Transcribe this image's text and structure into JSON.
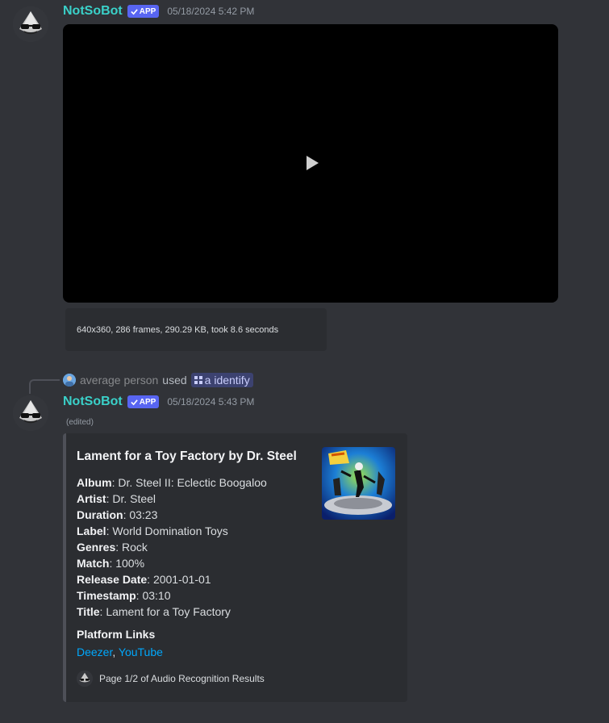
{
  "messages": [
    {
      "username": "NotSoBot",
      "badge": "APP",
      "timestamp": "05/18/2024 5:42 PM",
      "attachment_stats": "640x360, 286 frames, 290.29 KB, took 8.6 seconds"
    },
    {
      "reply": {
        "user": "average person",
        "used": "used",
        "command": "a identify"
      },
      "username": "NotSoBot",
      "badge": "APP",
      "timestamp": "05/18/2024 5:43 PM",
      "edited": "(edited)",
      "embed": {
        "title": "Lament for a Toy Factory by Dr. Steel",
        "fields": [
          {
            "name": "Album",
            "value": "Dr. Steel II: Eclectic Boogaloo"
          },
          {
            "name": "Artist",
            "value": "Dr. Steel"
          },
          {
            "name": "Duration",
            "value": "03:23"
          },
          {
            "name": "Label",
            "value": "World Domination Toys"
          },
          {
            "name": "Genres",
            "value": "Rock"
          },
          {
            "name": "Match",
            "value": "100%"
          },
          {
            "name": "Release Date",
            "value": "2001-01-01"
          },
          {
            "name": "Timestamp",
            "value": "03:10"
          },
          {
            "name": "Title",
            "value": "Lament for a Toy Factory"
          }
        ],
        "platform_title": "Platform Links",
        "links": [
          "Deezer",
          "YouTube"
        ],
        "link_separator": ", ",
        "footer": "Page 1/2 of Audio Recognition Results"
      }
    }
  ],
  "colors": {
    "background": "#313338",
    "username": "#3ad1c9",
    "badge": "#5865f2",
    "link": "#00a8fc",
    "embed_bg": "#2b2d31"
  }
}
